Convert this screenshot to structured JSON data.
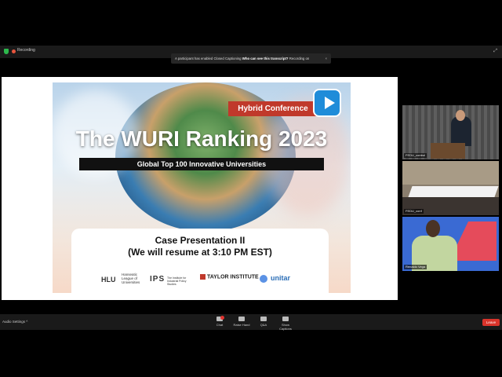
{
  "top_bar": {
    "recording_label": "Recording"
  },
  "notice": {
    "text": "A participant has enabled Closed Captioning",
    "question": "Who can see this transcript?",
    "recording": "Recording on",
    "close": "×"
  },
  "slide": {
    "badge": "Hybrid Conference",
    "title": "The WURI Ranking 2023",
    "subtitle": "Global Top 100 Innovative Universities",
    "case_line1": "Case Presentation II",
    "case_line2": "(We will resume at 3:10 PM EST)",
    "logos": {
      "hlu": "HLU",
      "hlu_name": "Hanseatic League of Universities",
      "ips": "IPS",
      "ips_name": "The Institute for Industrial Policy Studies",
      "taylor": "TAYLOR INSTITUTE",
      "unitar": "unitar"
    }
  },
  "participants": [
    {
      "name": "FEDU_control"
    },
    {
      "name": "FEDU_conf"
    },
    {
      "name": "Renaldo Vega"
    }
  ],
  "bottom_bar": {
    "audio_label": "Audio Settings",
    "buttons": [
      "Chat",
      "Raise Hand",
      "Q&A",
      "Show Captions"
    ],
    "leave": "Leave"
  }
}
